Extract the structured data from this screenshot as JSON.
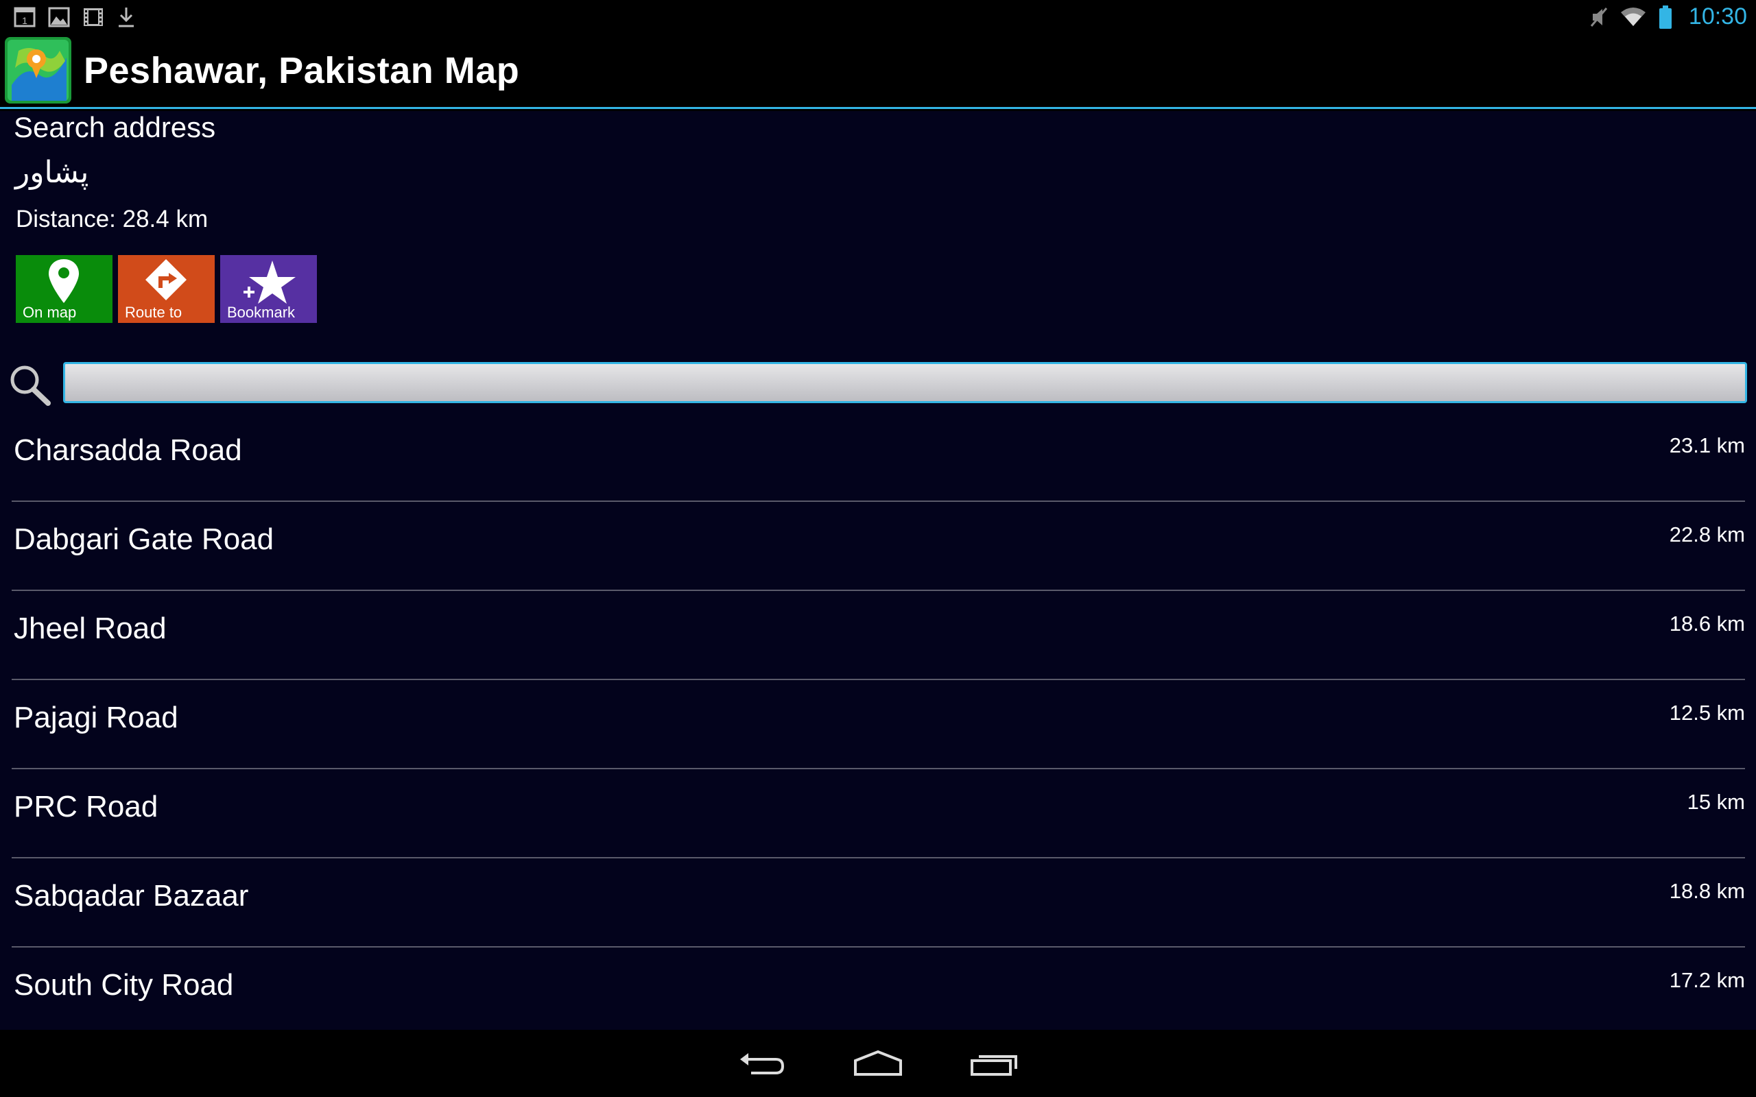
{
  "status_bar": {
    "time": "10:30",
    "icons": [
      "calendar-icon",
      "gallery-icon",
      "film-icon",
      "download-icon",
      "mute-icon",
      "wifi-icon",
      "battery-icon"
    ],
    "calendar_day": "1"
  },
  "action_bar": {
    "title": "Peshawar, Pakistan Map",
    "icon": "map-app-icon"
  },
  "detail": {
    "header": "Search address",
    "native_name": "پشاور",
    "distance": "Distance: 28.4 km"
  },
  "tiles": [
    {
      "label": "On map",
      "icon": "map-pin-icon",
      "color": "#098c0b"
    },
    {
      "label": "Route to",
      "icon": "route-icon",
      "color": "#d14b1a"
    },
    {
      "label": "Bookmark",
      "icon": "bookmark-star-icon",
      "color": "#5630a2"
    }
  ],
  "search": {
    "value": "",
    "placeholder": ""
  },
  "results": [
    {
      "name": "Charsadda Road",
      "distance": "23.1 km"
    },
    {
      "name": "Dabgari Gate Road",
      "distance": "22.8 km"
    },
    {
      "name": "Jheel Road",
      "distance": "18.6 km"
    },
    {
      "name": "Pajagi Road",
      "distance": "12.5 km"
    },
    {
      "name": "PRC Road",
      "distance": "15 km"
    },
    {
      "name": "Sabqadar Bazaar",
      "distance": "18.8 km"
    },
    {
      "name": "South City Road",
      "distance": "17.2 km"
    }
  ],
  "colors": {
    "accent": "#33b5e5",
    "background": "#03031c"
  },
  "nav_bar": {
    "buttons": [
      "back-icon",
      "home-icon",
      "recents-icon"
    ]
  }
}
